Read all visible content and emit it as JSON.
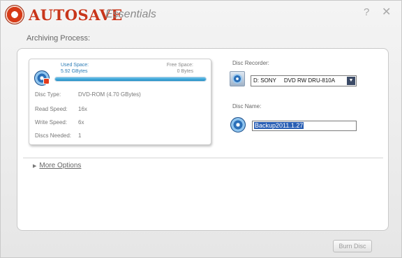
{
  "app": {
    "brand": "AUTOSAVE",
    "brand_sub": "Essentials",
    "help": "?",
    "close": "✕"
  },
  "section_title": "Archiving Process:",
  "disc_info": {
    "used_space_label": "Used Space:",
    "used_space_value": "5.92 GBytes",
    "free_space_label": "Free Space:",
    "free_space_value": "0 Bytes",
    "used_fraction": 1.0,
    "rows": [
      {
        "label": "Disc Type:",
        "value": "DVD-ROM (4.70 GBytes)"
      },
      {
        "label": "Read Speed:",
        "value": "16x"
      },
      {
        "label": "Write Speed:",
        "value": "6x"
      },
      {
        "label": "Discs Needed:",
        "value": "1"
      }
    ]
  },
  "recorder": {
    "label": "Disc Recorder:",
    "selected": "D: SONY     DVD RW DRU-810A"
  },
  "disc_name": {
    "label": "Disc Name:",
    "value": "Backup2011.1.27"
  },
  "more_options": "More Options",
  "burn_button": "Burn Disc",
  "colors": {
    "brand": "#c8361b",
    "accent": "#2a7bb5",
    "bar": "#1e8dc4"
  },
  "icons": {
    "logo": "lifebuoy-icon",
    "disc": "disc-icon",
    "recorder": "disc-recorder-icon"
  }
}
